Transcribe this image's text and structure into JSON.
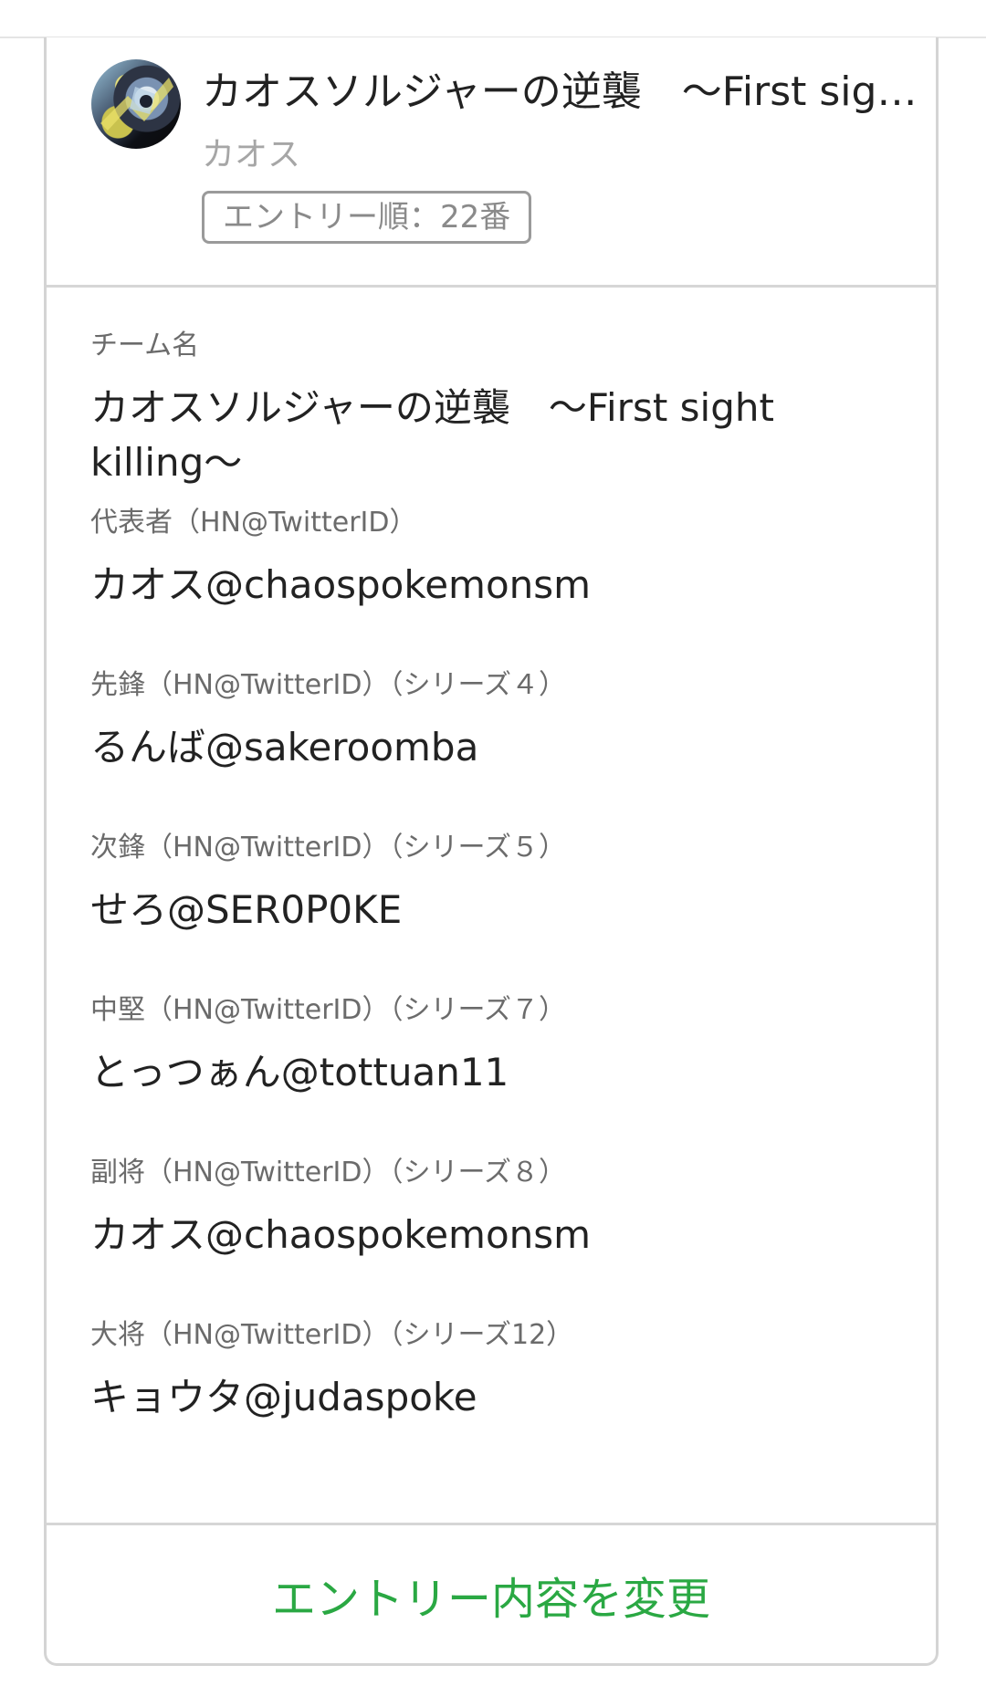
{
  "header": {
    "title": "カオスソルジャーの逆襲　〜First sight killing〜",
    "owner": "カオス",
    "entry_badge": "エントリー順：22番"
  },
  "fields": [
    {
      "label": "チーム名",
      "value": "カオスソルジャーの逆襲　〜First sight killing〜"
    },
    {
      "label": "代表者（HN@TwitterID）",
      "value": "カオス@chaospokemonsm"
    },
    {
      "label": "先鋒（HN@TwitterID）（シリーズ４）",
      "value": "るんば@sakeroomba"
    },
    {
      "label": "次鋒（HN@TwitterID）（シリーズ５）",
      "value": "せろ@SER0P0KE"
    },
    {
      "label": "中堅（HN@TwitterID）（シリーズ７）",
      "value": "とっつぁん@tottuan11"
    },
    {
      "label": "副将（HN@TwitterID）（シリーズ８）",
      "value": "カオス@chaospokemonsm"
    },
    {
      "label": "大将（HN@TwitterID）（シリーズ12）",
      "value": "キョウタ@judaspoke"
    }
  ],
  "footer": {
    "edit_label": "エントリー内容を変更"
  },
  "colors": {
    "accent": "#2aa843",
    "border": "#d6d6d6",
    "muted_text": "#a6a6a6"
  }
}
